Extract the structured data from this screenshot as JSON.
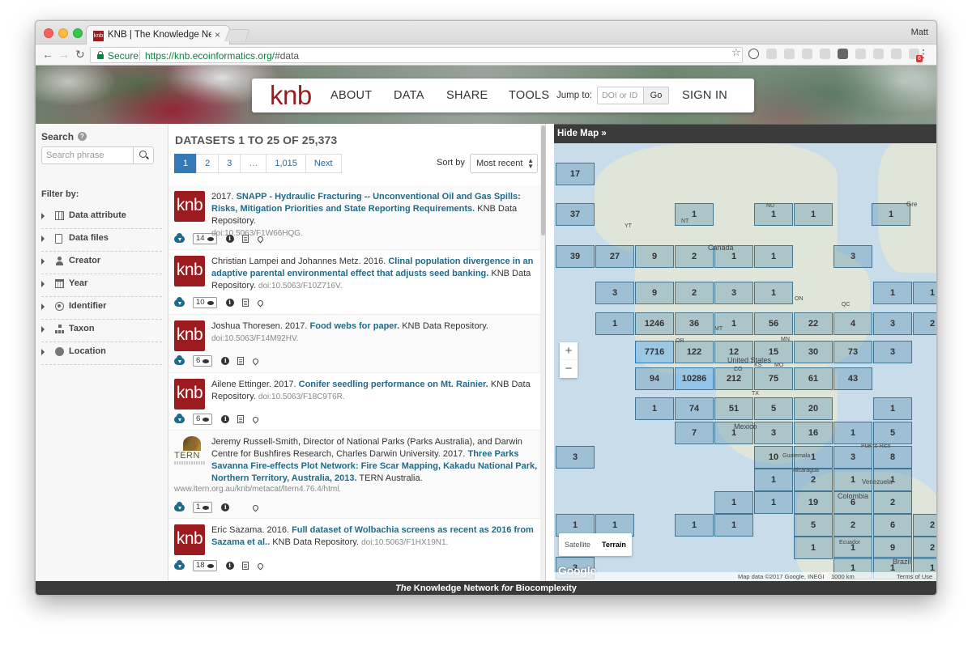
{
  "browser": {
    "tab_title": "KNB | The Knowledge Network",
    "tab_favicon": "knb",
    "tab_close": "×",
    "profile": "Matt",
    "secure_label": "Secure",
    "url_host": "https://knb.ecoinformatics.org/",
    "url_path": "#data",
    "ext_badge": "6"
  },
  "header": {
    "logo": "knb",
    "nav": [
      {
        "label": "ABOUT"
      },
      {
        "label": "DATA"
      },
      {
        "label": "SHARE"
      },
      {
        "label": "TOOLS"
      }
    ],
    "jump_label": "Jump to:",
    "jump_placeholder": "DOI or ID",
    "go_label": "Go",
    "signin_label": "SIGN IN"
  },
  "sidebar": {
    "search_label": "Search",
    "search_placeholder": "Search phrase",
    "filter_label": "Filter by:",
    "filters": [
      {
        "label": "Data attribute",
        "icon": "table-icon"
      },
      {
        "label": "Data files",
        "icon": "file-icon"
      },
      {
        "label": "Creator",
        "icon": "user-icon"
      },
      {
        "label": "Year",
        "icon": "calendar-icon"
      },
      {
        "label": "Identifier",
        "icon": "identifier-icon"
      },
      {
        "label": "Taxon",
        "icon": "taxon-icon"
      },
      {
        "label": "Location",
        "icon": "globe-icon"
      }
    ]
  },
  "results": {
    "title": "DATASETS 1 TO 25 OF 25,373",
    "pages": [
      "1",
      "2",
      "3",
      "…",
      "1,015",
      "Next"
    ],
    "sort_label": "Sort by",
    "sort_value": "Most recent",
    "items": [
      {
        "logo": "knb",
        "pre": "2017.",
        "title": "SNAPP - Hydraulic Fracturing -- Unconventional Oil and Gas Spills: Risks, Mitigation Priorities and State Reporting Requirements.",
        "post": "KNB Data Repository.",
        "doi": "doi:10.5063/F1W66HQG.",
        "views": "14"
      },
      {
        "logo": "knb",
        "pre": "Christian Lampei and Johannes Metz. 2016.",
        "title": "Clinal population divergence in an adaptive parental environmental effect that adjusts seed banking.",
        "post": "KNB Data Repository.",
        "doi": "doi:10.5063/F10Z716V.",
        "views": "10"
      },
      {
        "logo": "knb",
        "pre": "Joshua Thoresen. 2017.",
        "title": "Food webs for paper.",
        "post": "KNB Data Repository.",
        "doi": "doi:10.5063/F14M92HV.",
        "views": "6"
      },
      {
        "logo": "knb",
        "pre": "Ailene Ettinger. 2017.",
        "title": "Conifer seedling performance on Mt. Rainier.",
        "post": "KNB Data Repository.",
        "doi": "doi:10.5063/F18C9T6R.",
        "views": "6"
      },
      {
        "logo": "TERN",
        "pre": "Jeremy Russell-Smith, Director of National Parks (Parks Australia), and Darwin Centre for Bushfires Research, Charles Darwin University. 2017.",
        "title": "Three Parks Savanna Fire-effects Plot Network: Fire Scar Mapping, Kakadu National Park, Northern Territory, Australia, 2013.",
        "post": "TERN Australia.",
        "url": "www.ltern.org.au/knb/metacat/ltern4.76.4/html.",
        "views": "1"
      },
      {
        "logo": "knb",
        "pre": "Eric Sazama. 2016.",
        "title": "Full dataset of Wolbachia screens as recent as 2016 from Sazama et al..",
        "post": "KNB Data Repository.",
        "doi": "doi:10.5063/F1HX19N1.",
        "views": "18"
      }
    ]
  },
  "map": {
    "hide_label": "Hide Map",
    "hide_chevron": "»",
    "zoom_in": "+",
    "zoom_out": "−",
    "map_types": [
      "Satellite",
      "Terrain"
    ],
    "google": "Google",
    "attribution": "Map data ©2017 Google, INEGI",
    "scale": "1000 km",
    "terms": "Terms of Use",
    "place_labels": [
      "Canada",
      "United States",
      "Mexico",
      "Colombia",
      "Venezuela",
      "Brazil",
      "Ecuador",
      "Guatemala",
      "Nicaragua",
      "Puerto Rico",
      "NT",
      "NU",
      "YT",
      "ON",
      "QC",
      "OR",
      "MT",
      "CO",
      "KS",
      "MO",
      "MN",
      "TX",
      "Gre"
    ],
    "cells": [
      "17",
      "37",
      "1",
      "1",
      "1",
      "1",
      "39",
      "27",
      "9",
      "2",
      "1",
      "1",
      "3",
      "3",
      "9",
      "2",
      "3",
      "1",
      "1",
      "1",
      "1",
      "1246",
      "36",
      "1",
      "56",
      "22",
      "4",
      "3",
      "2",
      "7716",
      "122",
      "12",
      "15",
      "30",
      "73",
      "3",
      "94",
      "10286",
      "212",
      "75",
      "61",
      "43",
      "1",
      "74",
      "51",
      "5",
      "20",
      "1",
      "7",
      "1",
      "3",
      "16",
      "1",
      "5",
      "3",
      "10",
      "1",
      "3",
      "8",
      "1",
      "2",
      "1",
      "1",
      "1",
      "1",
      "19",
      "6",
      "2",
      "1",
      "1",
      "1",
      "1",
      "5",
      "2",
      "6",
      "2",
      "1",
      "1",
      "9",
      "2",
      "1",
      "1",
      "3",
      "1"
    ]
  },
  "footer": {
    "the": "The",
    "name": " Knowledge Network ",
    "for": "for",
    "end": " Biocomplexity"
  }
}
